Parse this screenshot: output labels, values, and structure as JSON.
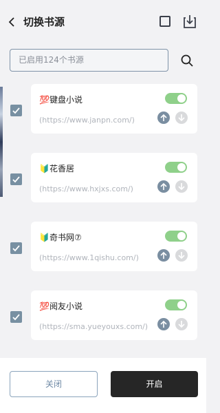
{
  "header": {
    "title": "切换书源",
    "back_icon": "chevron-left-icon",
    "select_all_icon": "checkbox-icon",
    "import_icon": "download-icon"
  },
  "search": {
    "placeholder": "已启用124个书源",
    "icon": "search-icon"
  },
  "sources": [
    {
      "emoji": "💯",
      "name": "键盘小说",
      "url": "(https://www.janpn.com/)",
      "checked": true,
      "enabled": true
    },
    {
      "emoji": "🔰",
      "name": "花香居",
      "url": "(https://www.hxjxs.com/)",
      "checked": true,
      "enabled": true
    },
    {
      "emoji": "🔰",
      "name": "奇书网⑦",
      "url": "(https://www.1qishu.com/)",
      "checked": true,
      "enabled": true
    },
    {
      "emoji": "💯",
      "name": "阅友小说",
      "url": "(https://sma.yueyouxs.com/)",
      "checked": true,
      "enabled": true
    }
  ],
  "footer": {
    "close_label": "关闭",
    "open_label": "开启"
  },
  "colors": {
    "accent": "#7890a2",
    "toggle_on": "#8fd08a",
    "primary_button": "#262626"
  }
}
